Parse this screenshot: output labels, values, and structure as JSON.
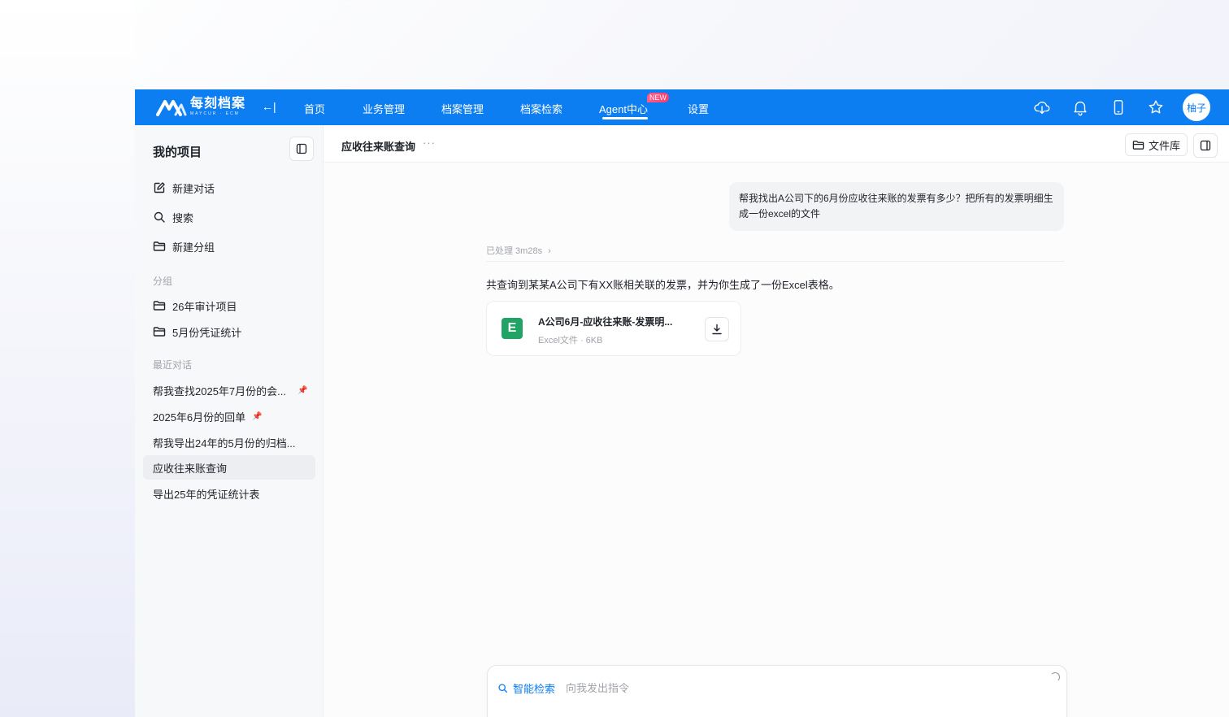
{
  "brand": {
    "name_cn": "每刻档案",
    "name_en": "MAYCUR · ECM"
  },
  "nav": {
    "collapse": "←|",
    "items": [
      {
        "label": "首页"
      },
      {
        "label": "业务管理"
      },
      {
        "label": "档案管理"
      },
      {
        "label": "档案检索"
      },
      {
        "label": "Agent中心",
        "active": true,
        "badge": "NEW"
      },
      {
        "label": "设置"
      }
    ],
    "icons": [
      "cloud-download-icon",
      "bell-icon",
      "mobile-icon",
      "star-icon"
    ],
    "avatar": "柚子"
  },
  "sidebar": {
    "title": "我的项目",
    "actions": [
      {
        "label": "新建对话",
        "icon": "edit-icon"
      },
      {
        "label": "搜索",
        "icon": "search-icon"
      },
      {
        "label": "新建分组",
        "icon": "folder-icon"
      }
    ],
    "groups_label": "分组",
    "groups": [
      {
        "label": "26年审计项目"
      },
      {
        "label": "5月份凭证统计"
      }
    ],
    "recent_label": "最近对话",
    "recent": [
      {
        "label": "帮我查找2025年7月份的会...",
        "pinned": true
      },
      {
        "label": "2025年6月份的回单",
        "pinned": true
      },
      {
        "label": "帮我导出24年的5月份的归档..."
      },
      {
        "label": "应收往来账查询",
        "active": true
      },
      {
        "label": "导出25年的凭证统计表"
      }
    ]
  },
  "conversation": {
    "title": "应收往来账查询",
    "more": "···",
    "library_label": "文件库",
    "user_message": "帮我找出A公司下的6月份应收往来账的发票有多少？把所有的发票明细生成一份excel的文件",
    "processed": "已处理 3m28s",
    "answer": "共查询到某某A公司下有XX账相关联的发票，并为你生成了一份Excel表格。",
    "file": {
      "icon_letter": "E",
      "name": "A公司6月-应收往来账-发票明...",
      "meta": "Excel文件 · 6KB"
    }
  },
  "composer": {
    "mode": "智能检索",
    "placeholder": "向我发出指令"
  },
  "colors": {
    "primary": "#0d7df2",
    "excel": "#21a366",
    "badge": "#ff3b6b"
  }
}
